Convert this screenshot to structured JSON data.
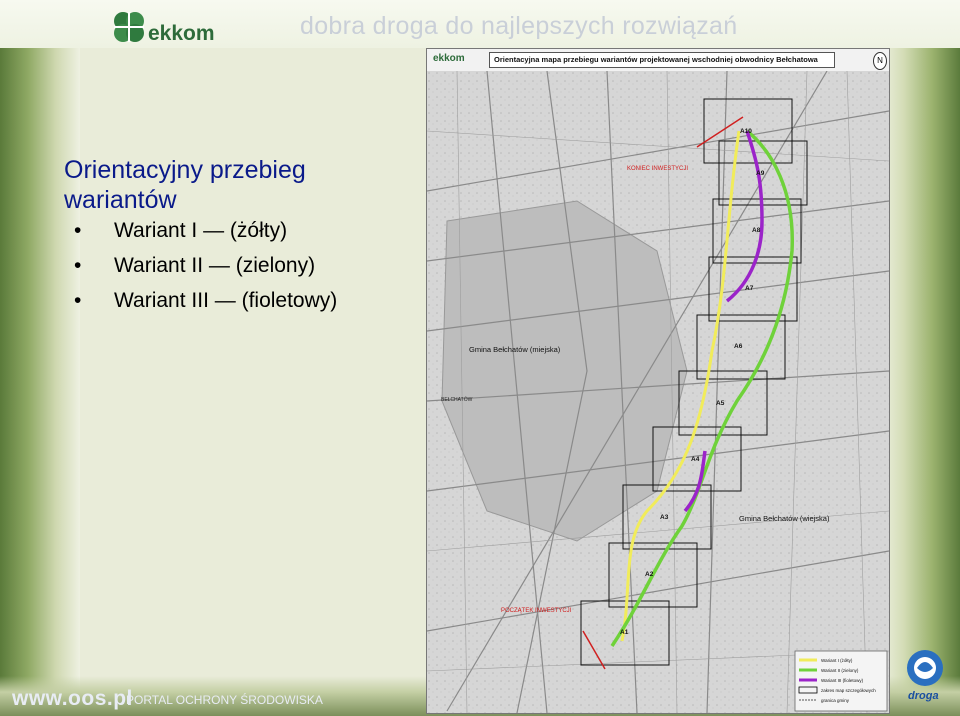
{
  "header": {
    "logo_text": "ekkom",
    "tagline": "dobra droga do najlepszych rozwiązań"
  },
  "slide": {
    "title": "Orientacyjny przebieg wariantów",
    "bullets": [
      "Wariant I — (żółty)",
      "Wariant II — (zielony)",
      "Wariant III — (fioletowy)"
    ]
  },
  "map": {
    "logo_text": "ekkom",
    "title": "Orientacyjna mapa przebiegu wariantów projektowanej wschodniej obwodnicy Bełchatowa",
    "north": "N",
    "labels": {
      "start": "POCZĄTEK INWESTYCJI",
      "end": "KONIEC INWESTYCJI",
      "gmina_miejska": "Gmina Bełchatów (miejska)",
      "gmina_wiejska": "Gmina Bełchatów (wiejska)",
      "city": "BEŁCHATÓW"
    },
    "sheets": [
      "A1",
      "A2",
      "A3",
      "A4",
      "A5",
      "A6",
      "A7",
      "A8",
      "A9",
      "A10"
    ],
    "legend": [
      {
        "label": "Wariant I (żółty)",
        "color": "#f1ec5a"
      },
      {
        "label": "Wariant II (zielony)",
        "color": "#6fd23a"
      },
      {
        "label": "Wariant III (fioletowy)",
        "color": "#9b24c9"
      },
      {
        "label": "zakres map szczegółowych",
        "color": "#000000"
      },
      {
        "label": "granica gminy",
        "color": "#555555"
      }
    ],
    "colors": {
      "yellow": "#f1ec5a",
      "green": "#6fd23a",
      "purple": "#9b24c9",
      "marker": "#d02020"
    }
  },
  "footer": {
    "url": "www.oos.pl",
    "portal": "PORTAL OCHRONY ŚRODOWISKA",
    "brand": "droga"
  }
}
